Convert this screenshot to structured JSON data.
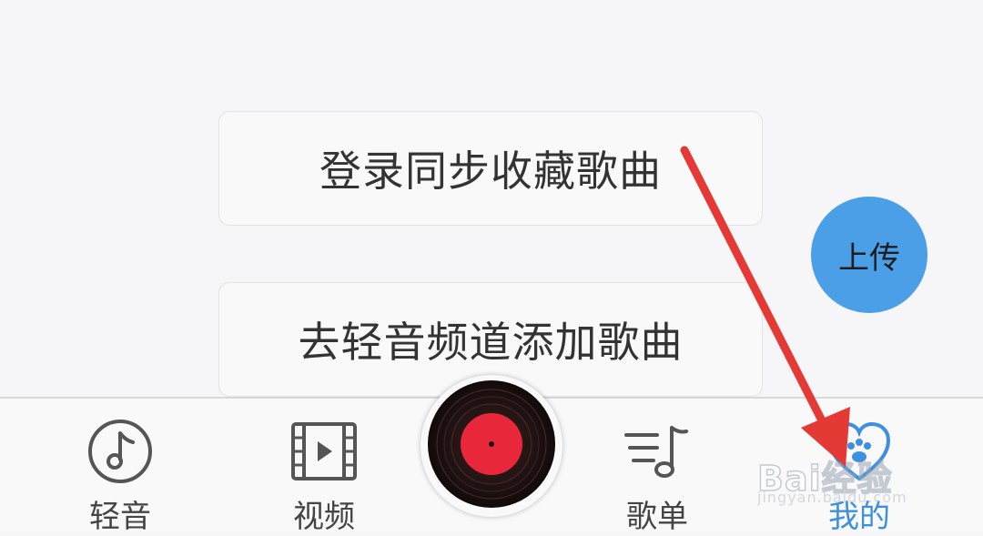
{
  "main": {
    "login_sync_label": "登录同步收藏歌曲",
    "add_songs_label": "去轻音频道添加歌曲",
    "upload_label": "上传"
  },
  "tabbar": {
    "tabs": [
      {
        "label": "轻音",
        "icon": "music-note-circle-icon"
      },
      {
        "label": "视频",
        "icon": "film-play-icon"
      },
      {
        "label": "歌单",
        "icon": "playlist-icon"
      },
      {
        "label": "我的",
        "icon": "heart-paw-icon",
        "active": true
      }
    ],
    "player_icon": "vinyl-record-icon"
  },
  "colors": {
    "accent": "#3d8fe0",
    "upload_button": "#4a9fe6",
    "arrow": "#e53935",
    "record_label": "#e8283a"
  },
  "watermark": {
    "brand": "Bai经验",
    "url": "jingyan.baidu.com"
  }
}
